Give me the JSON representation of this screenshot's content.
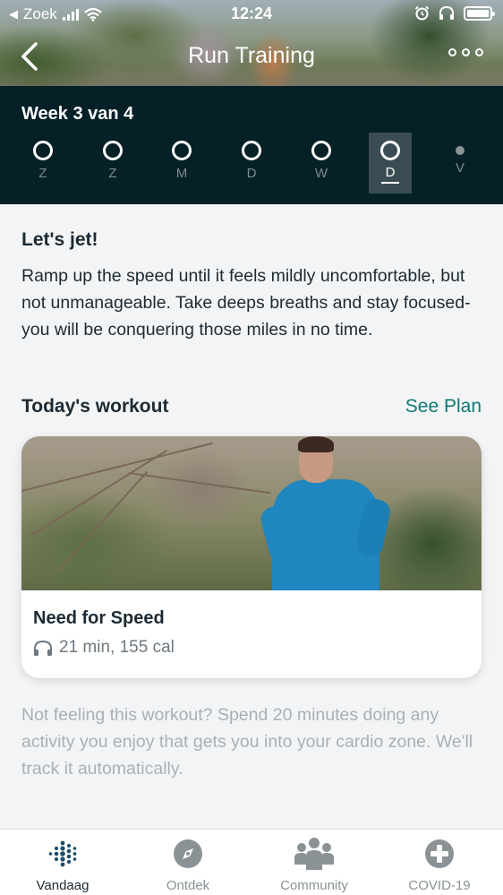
{
  "status_bar": {
    "carrier": "Zoek",
    "time": "12:24"
  },
  "nav": {
    "title": "Run Training"
  },
  "week": {
    "title": "Week 3 van 4",
    "days": [
      {
        "label": "Z",
        "state": "open"
      },
      {
        "label": "Z",
        "state": "open"
      },
      {
        "label": "M",
        "state": "open"
      },
      {
        "label": "D",
        "state": "open"
      },
      {
        "label": "W",
        "state": "open"
      },
      {
        "label": "D",
        "state": "selected"
      },
      {
        "label": "V",
        "state": "dot"
      }
    ]
  },
  "motto": {
    "title": "Let's jet!",
    "body": "Ramp up the speed until it feels mildly uncomfortable, but not unmanageable. Take deeps breaths and stay focused-you will be conquering those miles in no time."
  },
  "workout_section": {
    "title": "Today's workout",
    "link": "See Plan"
  },
  "workout_card": {
    "name": "Need for Speed",
    "meta": "21 min, 155 cal",
    "meta_icon": "headphones-icon"
  },
  "alt_text": "Not feeling this workout? Spend 20 minutes doing any activity you enjoy that gets you into your cardio zone. We'll track it automatically.",
  "tabs": [
    {
      "label": "Vandaag",
      "icon": "fitbit-dots-icon",
      "active": true
    },
    {
      "label": "Ontdek",
      "icon": "compass-icon",
      "active": false
    },
    {
      "label": "Community",
      "icon": "people-icon",
      "active": false
    },
    {
      "label": "COVID-19",
      "icon": "plus-circle-icon",
      "active": false
    }
  ],
  "colors": {
    "accent": "#0b7a74",
    "week_band": "#062028",
    "tab_active": "#1d2a33",
    "tab_inactive": "#8a9296"
  }
}
